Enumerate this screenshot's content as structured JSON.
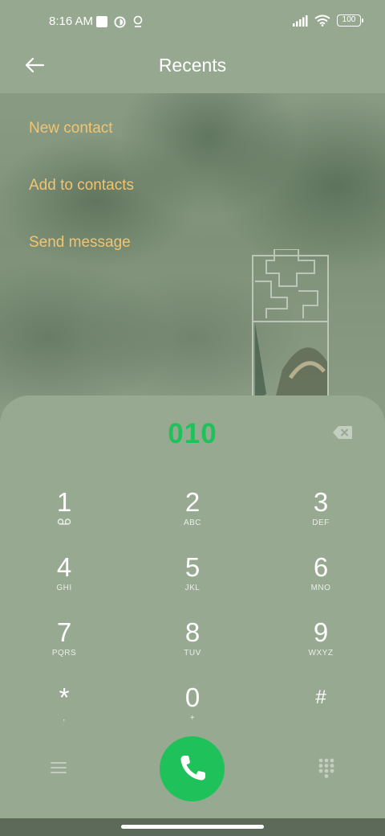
{
  "status_bar": {
    "time": "8:16 AM",
    "battery": "100",
    "icons": [
      "notification-square-icon",
      "data-saver-icon",
      "location-pin-icon",
      "signal-icon",
      "wifi-icon",
      "battery-icon"
    ]
  },
  "header": {
    "title": "Recents",
    "back_icon": "back-arrow-icon"
  },
  "actions": [
    {
      "label": "New contact"
    },
    {
      "label": "Add to contacts"
    },
    {
      "label": "Send message"
    }
  ],
  "dialer": {
    "number": "010",
    "number_color": "#1fc15a",
    "keys": [
      {
        "digit": "1",
        "letters": ""
      },
      {
        "digit": "2",
        "letters": "ABC"
      },
      {
        "digit": "3",
        "letters": "DEF"
      },
      {
        "digit": "4",
        "letters": "GHI"
      },
      {
        "digit": "5",
        "letters": "JKL"
      },
      {
        "digit": "6",
        "letters": "MNO"
      },
      {
        "digit": "7",
        "letters": "PQRS"
      },
      {
        "digit": "8",
        "letters": "TUV"
      },
      {
        "digit": "9",
        "letters": "WXYZ"
      },
      {
        "digit": "*",
        "letters": ","
      },
      {
        "digit": "0",
        "letters": "+"
      },
      {
        "digit": "#",
        "letters": ""
      }
    ]
  },
  "colors": {
    "accent_action": "#f3c46f",
    "call_button": "#1fc15a"
  }
}
